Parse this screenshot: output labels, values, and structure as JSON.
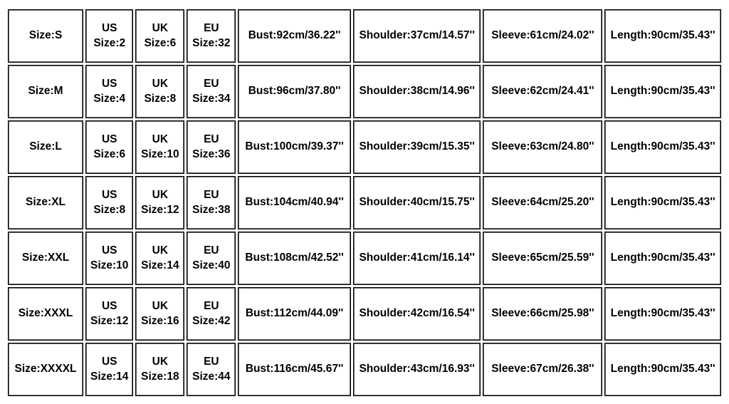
{
  "chart_data": {
    "type": "table",
    "columns": [
      "Size",
      "US Size",
      "UK Size",
      "EU Size",
      "Bust",
      "Shoulder",
      "Sleeve",
      "Length"
    ],
    "rows": [
      {
        "size": "S",
        "us": "2",
        "uk": "6",
        "eu": "32",
        "bust_cm": "92",
        "bust_in": "36.22",
        "shoulder_cm": "37",
        "shoulder_in": "14.57",
        "sleeve_cm": "61",
        "sleeve_in": "24.02",
        "length_cm": "90",
        "length_in": "35.43"
      },
      {
        "size": "M",
        "us": "4",
        "uk": "8",
        "eu": "34",
        "bust_cm": "96",
        "bust_in": "37.80",
        "shoulder_cm": "38",
        "shoulder_in": "14.96",
        "sleeve_cm": "62",
        "sleeve_in": "24.41",
        "length_cm": "90",
        "length_in": "35.43"
      },
      {
        "size": "L",
        "us": "6",
        "uk": "10",
        "eu": "36",
        "bust_cm": "100",
        "bust_in": "39.37",
        "shoulder_cm": "39",
        "shoulder_in": "15.35",
        "sleeve_cm": "63",
        "sleeve_in": "24.80",
        "length_cm": "90",
        "length_in": "35.43"
      },
      {
        "size": "XL",
        "us": "8",
        "uk": "12",
        "eu": "38",
        "bust_cm": "104",
        "bust_in": "40.94",
        "shoulder_cm": "40",
        "shoulder_in": "15.75",
        "sleeve_cm": "64",
        "sleeve_in": "25.20",
        "length_cm": "90",
        "length_in": "35.43"
      },
      {
        "size": "XXL",
        "us": "10",
        "uk": "14",
        "eu": "40",
        "bust_cm": "108",
        "bust_in": "42.52",
        "shoulder_cm": "41",
        "shoulder_in": "16.14",
        "sleeve_cm": "65",
        "sleeve_in": "25.59",
        "length_cm": "90",
        "length_in": "35.43"
      },
      {
        "size": "XXXL",
        "us": "12",
        "uk": "16",
        "eu": "42",
        "bust_cm": "112",
        "bust_in": "44.09",
        "shoulder_cm": "42",
        "shoulder_in": "16.54",
        "sleeve_cm": "66",
        "sleeve_in": "25.98",
        "length_cm": "90",
        "length_in": "35.43"
      },
      {
        "size": "XXXXL",
        "us": "14",
        "uk": "18",
        "eu": "44",
        "bust_cm": "116",
        "bust_in": "45.67",
        "shoulder_cm": "43",
        "shoulder_in": "16.93",
        "sleeve_cm": "67",
        "sleeve_in": "26.38",
        "length_cm": "90",
        "length_in": "35.43"
      }
    ]
  },
  "labels": {
    "size": "Size:",
    "us": "US",
    "uk": "UK",
    "eu": "EU",
    "size_colon": "Size:",
    "bust": "Bust:",
    "shoulder": "Shoulder:",
    "sleeve": "Sleeve:",
    "length": "Length:",
    "cm": "cm",
    "inch": "''",
    "sep": "/"
  }
}
